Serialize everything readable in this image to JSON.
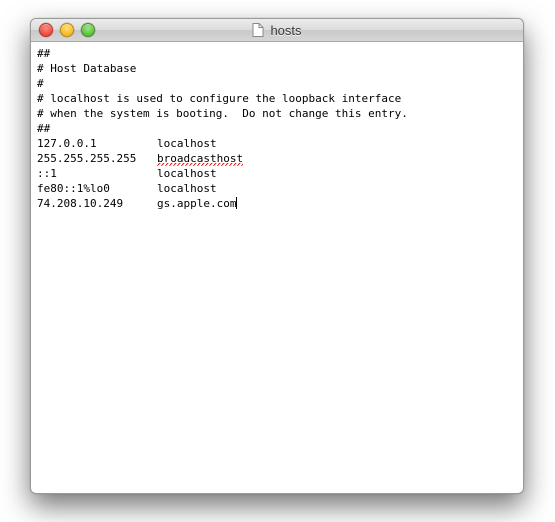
{
  "window": {
    "title": "hosts"
  },
  "lines": {
    "l0": "##",
    "l1": "# Host Database",
    "l2": "#",
    "l3": "# localhost is used to configure the loopback interface",
    "l4": "# when the system is booting.  Do not change this entry.",
    "l5": "##"
  },
  "entries": {
    "e0": {
      "ip": "127.0.0.1",
      "host": "localhost"
    },
    "e1": {
      "ip": "255.255.255.255",
      "host": "broadcasthost"
    },
    "e2": {
      "ip": "::1",
      "host": "localhost"
    },
    "e3": {
      "ip": "fe80::1%lo0",
      "host": "localhost"
    },
    "e4": {
      "ip": "74.208.10.249",
      "host": "gs.apple.com"
    }
  }
}
